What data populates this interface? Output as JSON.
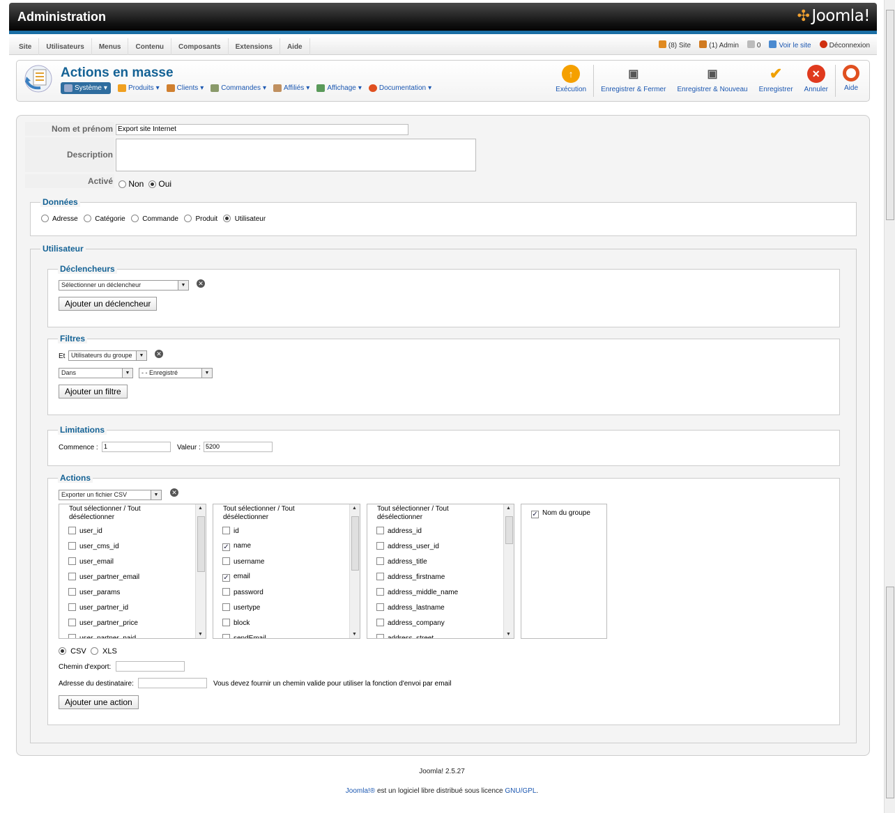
{
  "header": {
    "title": "Administration",
    "logo": "Joomla!"
  },
  "menubar": {
    "items": [
      "Site",
      "Utilisateurs",
      "Menus",
      "Contenu",
      "Composants",
      "Extensions",
      "Aide"
    ],
    "status": {
      "site": "(8) Site",
      "admin": "(1) Admin",
      "messages": "0",
      "view_site": "Voir le site",
      "logout": "Déconnexion"
    }
  },
  "toolbar": {
    "page_title": "Actions en masse",
    "submenu": [
      {
        "label": "Système",
        "icon": "wand-icon"
      },
      {
        "label": "Produits",
        "icon": "box-icon"
      },
      {
        "label": "Clients",
        "icon": "users-icon"
      },
      {
        "label": "Commandes",
        "icon": "cart-icon"
      },
      {
        "label": "Affiliés",
        "icon": "affiliates-icon"
      },
      {
        "label": "Affichage",
        "icon": "display-icon"
      },
      {
        "label": "Documentation",
        "icon": "lifebuoy-icon"
      }
    ],
    "buttons": {
      "run": "Exécution",
      "save_close": "Enregistrer & Fermer",
      "save_new": "Enregistrer & Nouveau",
      "save": "Enregistrer",
      "cancel": "Annuler",
      "help": "Aide"
    },
    "colors": {
      "run": "#f5a000",
      "cancel": "#e03a1e",
      "save": "#f0a000",
      "help": "#e05020"
    }
  },
  "form": {
    "name_label": "Nom et prénom",
    "name_value": "Export site Internet",
    "description_label": "Description",
    "active_label": "Activé",
    "active_no": "Non",
    "active_yes": "Oui",
    "data_legend": "Données",
    "data_options": [
      "Adresse",
      "Catégorie",
      "Commande",
      "Produit",
      "Utilisateur"
    ],
    "user_legend": "Utilisateur",
    "triggers": {
      "legend": "Déclencheurs",
      "select": "Sélectionner un déclencheur",
      "add_button": "Ajouter un déclencheur"
    },
    "filters": {
      "legend": "Filtres",
      "and_label": "Et",
      "group_select": "Utilisateurs du groupe",
      "in_select": "Dans",
      "registered_select": "- - Enregistré",
      "add_button": "Ajouter un filtre"
    },
    "limits": {
      "legend": "Limitations",
      "start_label": "Commence :",
      "start_value": "1",
      "value_label": "Valeur :",
      "value_value": "5200"
    },
    "actions": {
      "legend": "Actions",
      "select": "Exporter un fichier CSV",
      "list_header": "Tout sélectionner / Tout désélectionner",
      "col1": [
        "user_id",
        "user_cms_id",
        "user_email",
        "user_partner_email",
        "user_params",
        "user_partner_id",
        "user_partner_price",
        "user_partner_paid"
      ],
      "col2": [
        "id",
        "name",
        "username",
        "email",
        "password",
        "usertype",
        "block",
        "sendEmail"
      ],
      "col2_checked": [
        false,
        true,
        false,
        true,
        false,
        false,
        false,
        false
      ],
      "col3": [
        "address_id",
        "address_user_id",
        "address_title",
        "address_firstname",
        "address_middle_name",
        "address_lastname",
        "address_company",
        "address_street"
      ],
      "group_name": "Nom du groupe",
      "format_csv": "CSV",
      "format_xls": "XLS",
      "export_path_label": "Chemin d'export:",
      "recipient_label": "Adresse du destinataire:",
      "recipient_hint": "Vous devez fournir un chemin valide pour utiliser la fonction d'envoi par email",
      "add_button": "Ajouter une action"
    }
  },
  "footer": {
    "version": "Joomla! 2.5.27",
    "license_link": "Joomla!®",
    "license_text": " est un logiciel libre distribué sous licence ",
    "gpl_link": "GNU/GPL",
    "end": "."
  }
}
